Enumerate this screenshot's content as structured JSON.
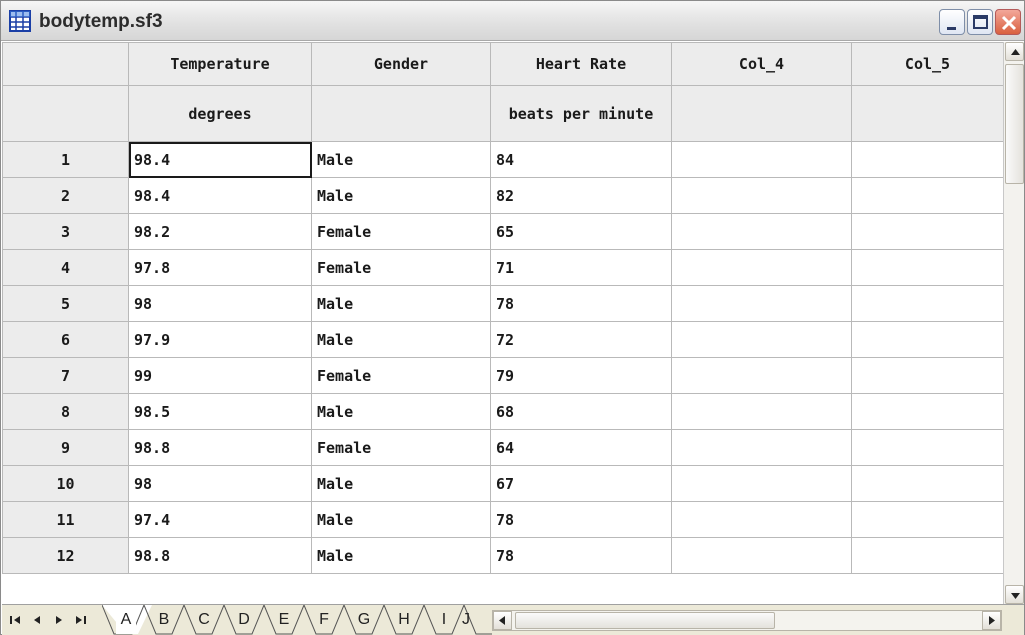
{
  "window": {
    "title": "bodytemp.sf3",
    "icon": "spreadsheet-grid-icon"
  },
  "columns": [
    {
      "name": "Temperature",
      "unit": "degrees"
    },
    {
      "name": "Gender",
      "unit": ""
    },
    {
      "name": "Heart Rate",
      "unit": "beats per minute"
    },
    {
      "name": "Col_4",
      "unit": ""
    },
    {
      "name": "Col_5",
      "unit": ""
    }
  ],
  "rows": [
    {
      "num": "1",
      "temperature": "98.4",
      "gender": "Male",
      "heart_rate": "84"
    },
    {
      "num": "2",
      "temperature": "98.4",
      "gender": "Male",
      "heart_rate": "82"
    },
    {
      "num": "3",
      "temperature": "98.2",
      "gender": "Female",
      "heart_rate": "65"
    },
    {
      "num": "4",
      "temperature": "97.8",
      "gender": "Female",
      "heart_rate": "71"
    },
    {
      "num": "5",
      "temperature": "98",
      "gender": "Male",
      "heart_rate": "78"
    },
    {
      "num": "6",
      "temperature": "97.9",
      "gender": "Male",
      "heart_rate": "72"
    },
    {
      "num": "7",
      "temperature": "99",
      "gender": "Female",
      "heart_rate": "79"
    },
    {
      "num": "8",
      "temperature": "98.5",
      "gender": "Male",
      "heart_rate": "68"
    },
    {
      "num": "9",
      "temperature": "98.8",
      "gender": "Female",
      "heart_rate": "64"
    },
    {
      "num": "10",
      "temperature": "98",
      "gender": "Male",
      "heart_rate": "67"
    },
    {
      "num": "11",
      "temperature": "97.4",
      "gender": "Male",
      "heart_rate": "78"
    },
    {
      "num": "12",
      "temperature": "98.8",
      "gender": "Male",
      "heart_rate": "78"
    }
  ],
  "sheet_tabs": [
    "A",
    "B",
    "C",
    "D",
    "E",
    "F",
    "G",
    "H",
    "I",
    "J"
  ],
  "active_tab": "A",
  "colors": {
    "header_bg": "#ececec",
    "grid_line": "#b9b9b9",
    "close_button": "#d9603f"
  }
}
